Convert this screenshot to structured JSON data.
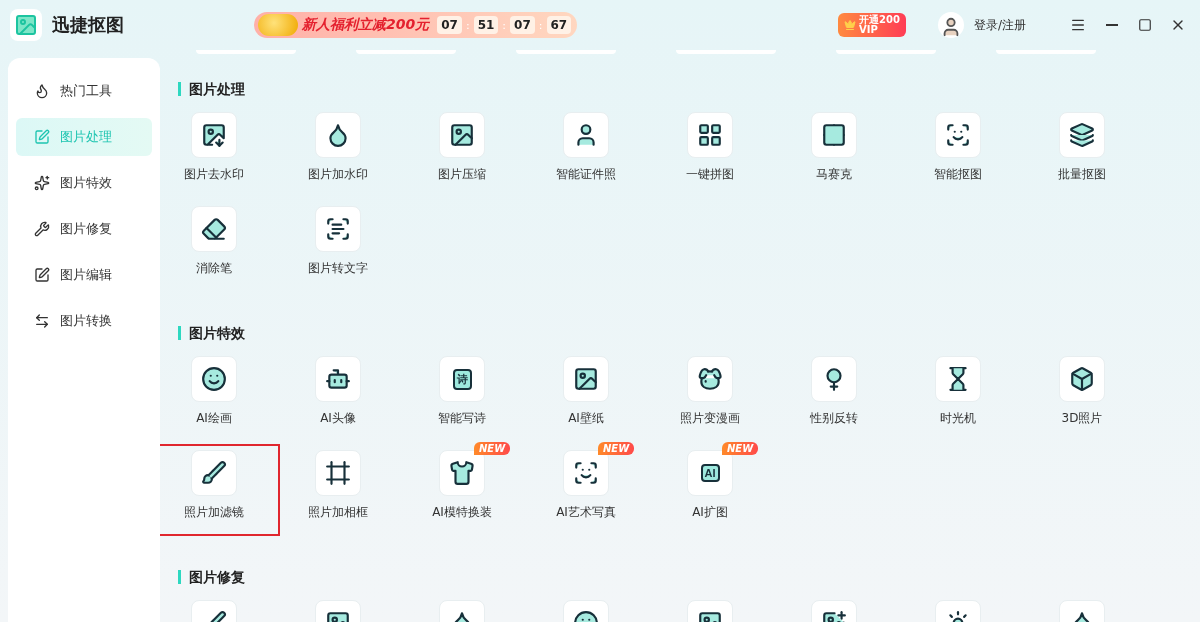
{
  "app": {
    "title": "迅捷抠图"
  },
  "promo": {
    "text": "新人福利立减200元",
    "separator": ":",
    "timer": [
      "07",
      "51",
      "07",
      "67"
    ]
  },
  "vip": {
    "top": "开通",
    "bottom": "VIP",
    "amount": "200"
  },
  "user": {
    "label": "登录/注册"
  },
  "sidebar": {
    "items": [
      {
        "label": "热门工具",
        "selected": false
      },
      {
        "label": "图片处理",
        "selected": true
      },
      {
        "label": "图片特效",
        "selected": false
      },
      {
        "label": "图片修复",
        "selected": false
      },
      {
        "label": "图片编辑",
        "selected": false
      },
      {
        "label": "图片转换",
        "selected": false
      }
    ]
  },
  "sections": [
    {
      "title": "图片处理",
      "items": [
        {
          "kind": "tool",
          "label": "图片去水印",
          "highlighted": false
        },
        {
          "kind": "tool",
          "label": "图片加水印",
          "highlighted": false
        },
        {
          "kind": "tool",
          "label": "图片压缩",
          "highlighted": false
        },
        {
          "kind": "tool",
          "label": "智能证件照",
          "highlighted": false
        },
        {
          "kind": "tool",
          "label": "一键拼图",
          "highlighted": false
        },
        {
          "kind": "tool",
          "label": "马赛克",
          "highlighted": false
        },
        {
          "kind": "tool",
          "label": "智能抠图",
          "highlighted": false
        },
        {
          "kind": "tool",
          "label": "批量抠图",
          "highlighted": false
        },
        {
          "kind": "tool",
          "label": "消除笔",
          "highlighted": false
        },
        {
          "kind": "tool",
          "label": "图片转文字",
          "highlighted": false
        }
      ]
    },
    {
      "title": "图片特效",
      "items": [
        {
          "kind": "tool",
          "label": "AI绘画",
          "highlighted": false
        },
        {
          "kind": "tool",
          "label": "AI头像",
          "highlighted": false
        },
        {
          "kind": "tool",
          "label": "智能写诗",
          "highlighted": false,
          "glyph": "诗"
        },
        {
          "kind": "tool",
          "label": "AI壁纸",
          "highlighted": false
        },
        {
          "kind": "tool",
          "label": "照片变漫画",
          "highlighted": false
        },
        {
          "kind": "tool",
          "label": "性别反转",
          "highlighted": false
        },
        {
          "kind": "tool",
          "label": "时光机",
          "highlighted": false
        },
        {
          "kind": "tool",
          "label": "3D照片",
          "highlighted": false
        },
        {
          "kind": "tool",
          "label": "照片加滤镜",
          "highlighted": true
        },
        {
          "kind": "tool",
          "label": "照片加相框",
          "highlighted": false
        },
        {
          "kind": "tool",
          "label": "AI模特换装",
          "highlighted": false,
          "badge": "NEW"
        },
        {
          "kind": "tool",
          "label": "AI艺术写真",
          "highlighted": false,
          "badge": "NEW"
        },
        {
          "kind": "tool",
          "label": "AI扩图",
          "highlighted": false,
          "badge": "NEW",
          "glyph": "AI"
        }
      ]
    },
    {
      "title": "图片修复",
      "items": [
        {
          "kind": "cut"
        },
        {
          "kind": "cut"
        },
        {
          "kind": "cut"
        },
        {
          "kind": "cut"
        },
        {
          "kind": "cut"
        },
        {
          "kind": "cut"
        },
        {
          "kind": "cut"
        },
        {
          "kind": "cut"
        }
      ]
    }
  ]
}
